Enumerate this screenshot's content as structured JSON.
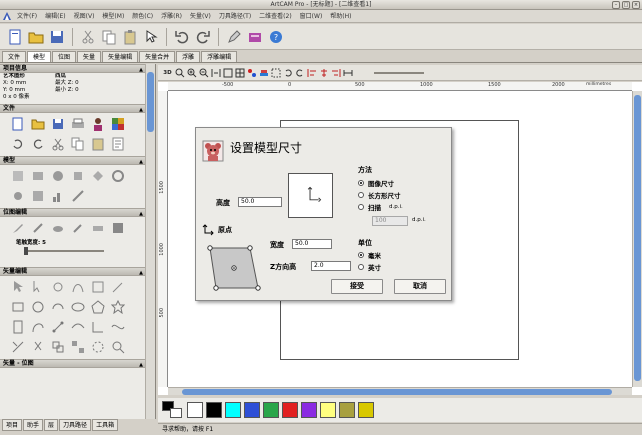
{
  "window": {
    "title": "ArtCAM Pro - [无标题] - [二维查看1]"
  },
  "menu": [
    "文件(F)",
    "编辑(E)",
    "视图(V)",
    "模型(M)",
    "颜色(C)",
    "浮雕(R)",
    "矢量(V)",
    "刀具路径(T)",
    "二维查看(2)",
    "窗口(W)",
    "帮助(H)"
  ],
  "tabs_top": [
    {
      "label": "文件"
    },
    {
      "label": "模型"
    },
    {
      "label": "位图"
    },
    {
      "label": "矢量"
    },
    {
      "label": "矢量编辑"
    },
    {
      "label": "矢量合并"
    },
    {
      "label": "浮雕"
    },
    {
      "label": "浮雕编辑"
    }
  ],
  "sidebar": {
    "project_info": {
      "title": "项目信息",
      "model_label": "艺术图形",
      "model_value": "西瓜",
      "x_label": "X: 0 mm",
      "y_label": "Y: 0 mm",
      "px_label": "0 x 0 像素",
      "maxz": "最大 Z: 0",
      "minz": "最小 Z: 0"
    },
    "sections": {
      "file": "文件",
      "model": "模型",
      "bitmap_edit": "位图编辑",
      "vector_edit": "矢量编辑",
      "vector_bitmap": "矢量 - 位图"
    },
    "brush_label": "笔触宽度: 5",
    "bottom_tabs": [
      "项目",
      "助手",
      "层",
      "刀具路径",
      "工具箱"
    ]
  },
  "toolbar2": {
    "t1": "3D"
  },
  "ruler": {
    "h": [
      "-500",
      "0",
      "500",
      "1000",
      "1500",
      "2000",
      "2500"
    ],
    "v": [
      "1500",
      "1000",
      "500"
    ],
    "units": "millimetres"
  },
  "palette": {
    "colors": [
      "#000000",
      "#ffffff",
      "#000000",
      "#00ffff",
      "#2e4fd6",
      "#2aa64a",
      "#e02020",
      "#8a2be2",
      "#ffff80",
      "#a8a040",
      "#d8c800"
    ]
  },
  "status": {
    "text": "寻求帮助，请按 F1"
  },
  "dialog": {
    "title": "设置模型尺寸",
    "height_label": "高度",
    "height_value": "50.0",
    "width_label": "宽度",
    "width_value": "50.0",
    "origin_label": "原点",
    "z_label": "Z方向高",
    "z_value": "2.0",
    "method_label": "方法",
    "method_options": [
      "图像尺寸",
      "长方形尺寸",
      "扫描"
    ],
    "dpi_label": "d.p.i.",
    "dpi_value": "100",
    "dpi_label2": "d.p.i.",
    "unit_label": "单位",
    "unit_options": [
      "毫米",
      "英寸"
    ],
    "ok_label": "接受",
    "cancel_label": "取消"
  }
}
